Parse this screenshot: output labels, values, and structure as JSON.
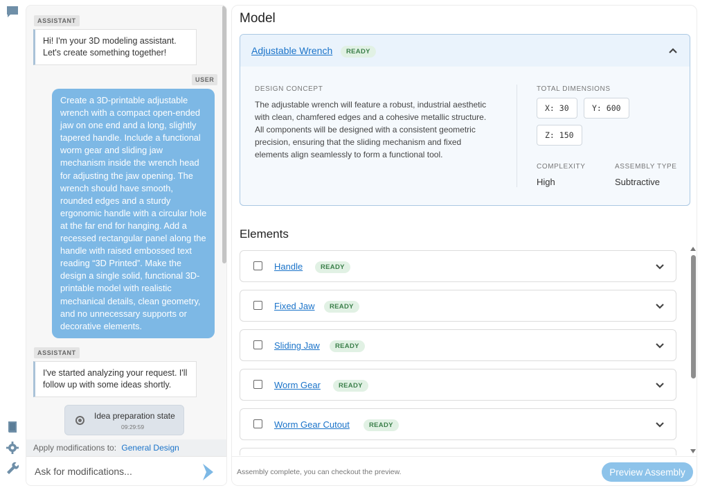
{
  "rail": {
    "icons": [
      "chat-icon",
      "book-icon",
      "gear-icon",
      "wrench-icon"
    ],
    "accent": "#6f8fa8"
  },
  "chat": {
    "messages": [
      {
        "role": "ASSISTANT",
        "text": "Hi! I'm your 3D modeling assistant. Let's create something together!"
      },
      {
        "role": "USER",
        "text": "Create a 3D-printable adjustable wrench with a compact open-ended jaw on one end and a long, slightly tapered handle. Include a functional worm gear and sliding jaw mechanism inside the wrench head for adjusting the jaw opening. The wrench should have smooth, rounded edges and a sturdy ergonomic handle with a circular hole at the far end for hanging. Add a recessed rectangular panel along the handle with raised embossed text reading “3D Printed”. Make the design a single solid, functional 3D-printable model with realistic mechanical details, clean geometry, and no unnecessary supports or decorative elements."
      },
      {
        "role": "ASSISTANT",
        "text": "I've started analyzing your request. I'll follow up with some ideas shortly."
      }
    ],
    "state": {
      "label": "Idea preparation state",
      "time": "09:29:59"
    },
    "apply_label": "Apply modifications to:",
    "apply_target": "General Design",
    "input_placeholder": "Ask for modifications..."
  },
  "model": {
    "heading": "Model",
    "title": "Adjustable Wrench",
    "status": "READY",
    "concept_label": "DESIGN CONCEPT",
    "concept_text": "The adjustable wrench will feature a robust, industrial aesthetic with clean, chamfered edges and a cohesive metallic structure. All components will be designed with a consistent geometric precision, ensuring that the sliding mechanism and fixed elements align seamlessly to form a functional tool.",
    "dimensions_label": "TOTAL DIMENSIONS",
    "dims": {
      "x": "X: 30",
      "y": "Y: 600",
      "z": "Z: 150"
    },
    "complexity_label": "COMPLEXITY",
    "complexity": "High",
    "assembly_label": "ASSEMBLY TYPE",
    "assembly": "Subtractive"
  },
  "elements": {
    "heading": "Elements",
    "items": [
      {
        "name": "Handle",
        "status": "READY"
      },
      {
        "name": "Fixed Jaw",
        "status": "READY"
      },
      {
        "name": "Sliding Jaw",
        "status": "READY"
      },
      {
        "name": "Worm Gear",
        "status": "READY"
      },
      {
        "name": "Worm Gear Cutout",
        "status": "READY"
      }
    ]
  },
  "footer": {
    "message": "Assembly complete, you can checkout the preview.",
    "button": "Preview Assembly"
  },
  "colors": {
    "link": "#1a73c9",
    "user_bubble": "#7db8e5",
    "ready_badge_bg": "#e1f1e4",
    "ready_badge_text": "#3b7f4a",
    "primary_button": "#8dc3ea"
  }
}
